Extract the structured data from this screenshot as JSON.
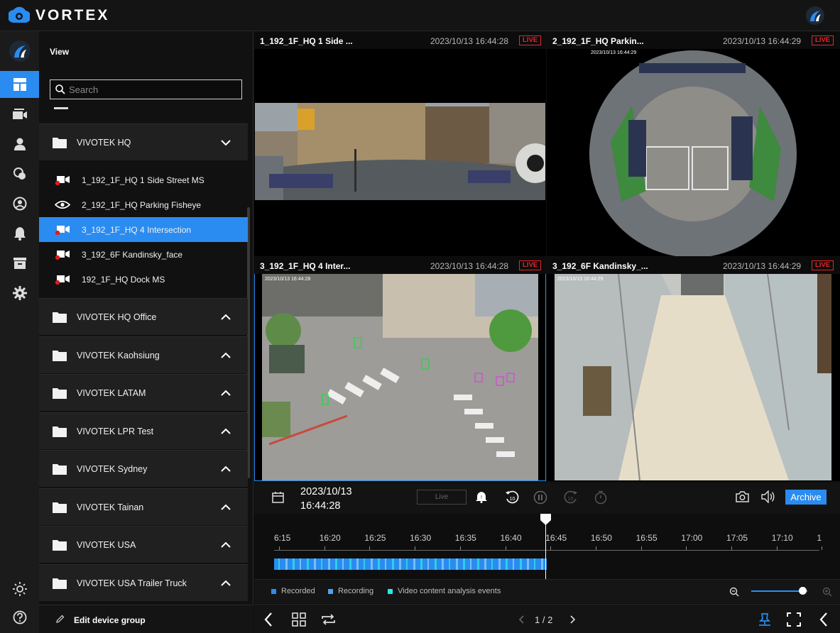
{
  "app": {
    "name": "VORTEX"
  },
  "sidebar": {
    "active_item": "views"
  },
  "panel": {
    "title": "View",
    "search_placeholder": "Search",
    "edit_label": "Edit device group",
    "groups": [
      {
        "label": "VIVOTEK HQ",
        "expanded": true
      },
      {
        "label": "VIVOTEK HQ Office",
        "expanded": false
      },
      {
        "label": "VIVOTEK Kaohsiung",
        "expanded": false
      },
      {
        "label": "VIVOTEK LATAM",
        "expanded": false
      },
      {
        "label": "VIVOTEK LPR Test",
        "expanded": false
      },
      {
        "label": "VIVOTEK Sydney",
        "expanded": false
      },
      {
        "label": "VIVOTEK Tainan",
        "expanded": false
      },
      {
        "label": "VIVOTEK USA",
        "expanded": false
      },
      {
        "label": "VIVOTEK USA Trailer Truck",
        "expanded": false
      }
    ],
    "cameras": [
      {
        "label": "1_192_1F_HQ 1 Side Street MS",
        "icon": "camera-recording-icon"
      },
      {
        "label": "2_192_1F_HQ Parking Fisheye",
        "icon": "eye-icon"
      },
      {
        "label": "3_192_1F_HQ 4 Intersection",
        "icon": "camera-recording-icon",
        "selected": true
      },
      {
        "label": "3_192_6F Kandinsky_face",
        "icon": "camera-recording-icon"
      },
      {
        "label": "192_1F_HQ Dock MS",
        "icon": "camera-recording-icon"
      }
    ]
  },
  "tiles": [
    {
      "name": "1_192_1F_HQ 1 Side ...",
      "time": "2023/10/13 16:44:28",
      "live": "LIVE",
      "overlay": ""
    },
    {
      "name": "2_192_1F_HQ Parkin...",
      "time": "2023/10/13 16:44:29",
      "live": "LIVE",
      "overlay": "2023/10/13 16:44:29"
    },
    {
      "name": "3_192_1F_HQ 4 Inter...",
      "time": "2023/10/13 16:44:28",
      "live": "LIVE",
      "overlay": "2023/10/13 16:44:28"
    },
    {
      "name": "3_192_6F Kandinsky_...",
      "time": "2023/10/13 16:44:29",
      "live": "LIVE",
      "overlay": "2023/10/13 16:44:29"
    }
  ],
  "playback": {
    "date": "2023/10/13",
    "time": "16:44:28",
    "live_label": "Live",
    "archive_label": "Archive"
  },
  "timeline": {
    "ticks": [
      "6:15",
      "16:20",
      "16:25",
      "16:30",
      "16:35",
      "16:40",
      "16:45",
      "16:50",
      "16:55",
      "17:00",
      "17:05",
      "17:10",
      "1"
    ],
    "zoom_level": 0.9
  },
  "legend": {
    "recorded": "Recorded",
    "recording": "Recording",
    "vca": "Video content analysis events",
    "colors": {
      "recorded": "#2a8cf0",
      "recording": "#4aa3f5",
      "vca": "#2ee6e6"
    }
  },
  "pager": {
    "current": "1",
    "separator": "/",
    "total": "2"
  }
}
